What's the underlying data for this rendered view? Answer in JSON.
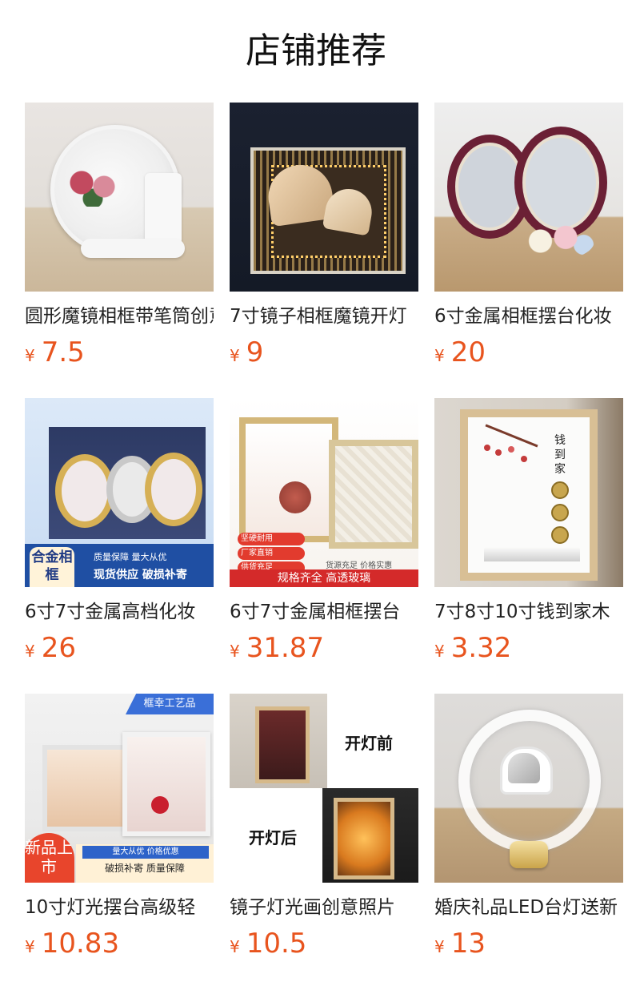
{
  "section_title": "店铺推荐",
  "currency_symbol": "¥",
  "products": [
    {
      "name": "圆形魔镜相框带笔筒创意摆台",
      "price": "7.5"
    },
    {
      "name": "7寸镜子相框魔镜开灯",
      "price": "9"
    },
    {
      "name": "6寸金属相框摆台化妆",
      "price": "20"
    },
    {
      "name": "6寸7寸金属高档化妆",
      "price": "26",
      "overlay": {
        "badge": "合金相框",
        "line1": "质量保障  量大从优",
        "line2": "现货供应  破损补寄"
      }
    },
    {
      "name": "6寸7寸金属相框摆台",
      "price": "31.87",
      "overlay": {
        "checks": [
          "坚硬耐用",
          "厂家直销",
          "供货充足"
        ],
        "side": "货源充足  价格实惠",
        "band": "规格齐全  高透玻璃"
      }
    },
    {
      "name": "7寸8寸10寸钱到家木",
      "price": "3.32",
      "overlay": {
        "calligraphy": "钱到家"
      }
    },
    {
      "name": "10寸灯光摆台高级轻",
      "price": "10.83",
      "overlay": {
        "corner": "框幸工艺品",
        "badge": "新品上市",
        "line1": "量大从优  价格优惠",
        "line2": "破损补寄  质量保障"
      }
    },
    {
      "name": "镜子灯光画创意照片",
      "price": "10.5",
      "overlay": {
        "before": "开灯前",
        "after": "开灯后"
      }
    },
    {
      "name": "婚庆礼品LED台灯送新",
      "price": "13"
    }
  ]
}
